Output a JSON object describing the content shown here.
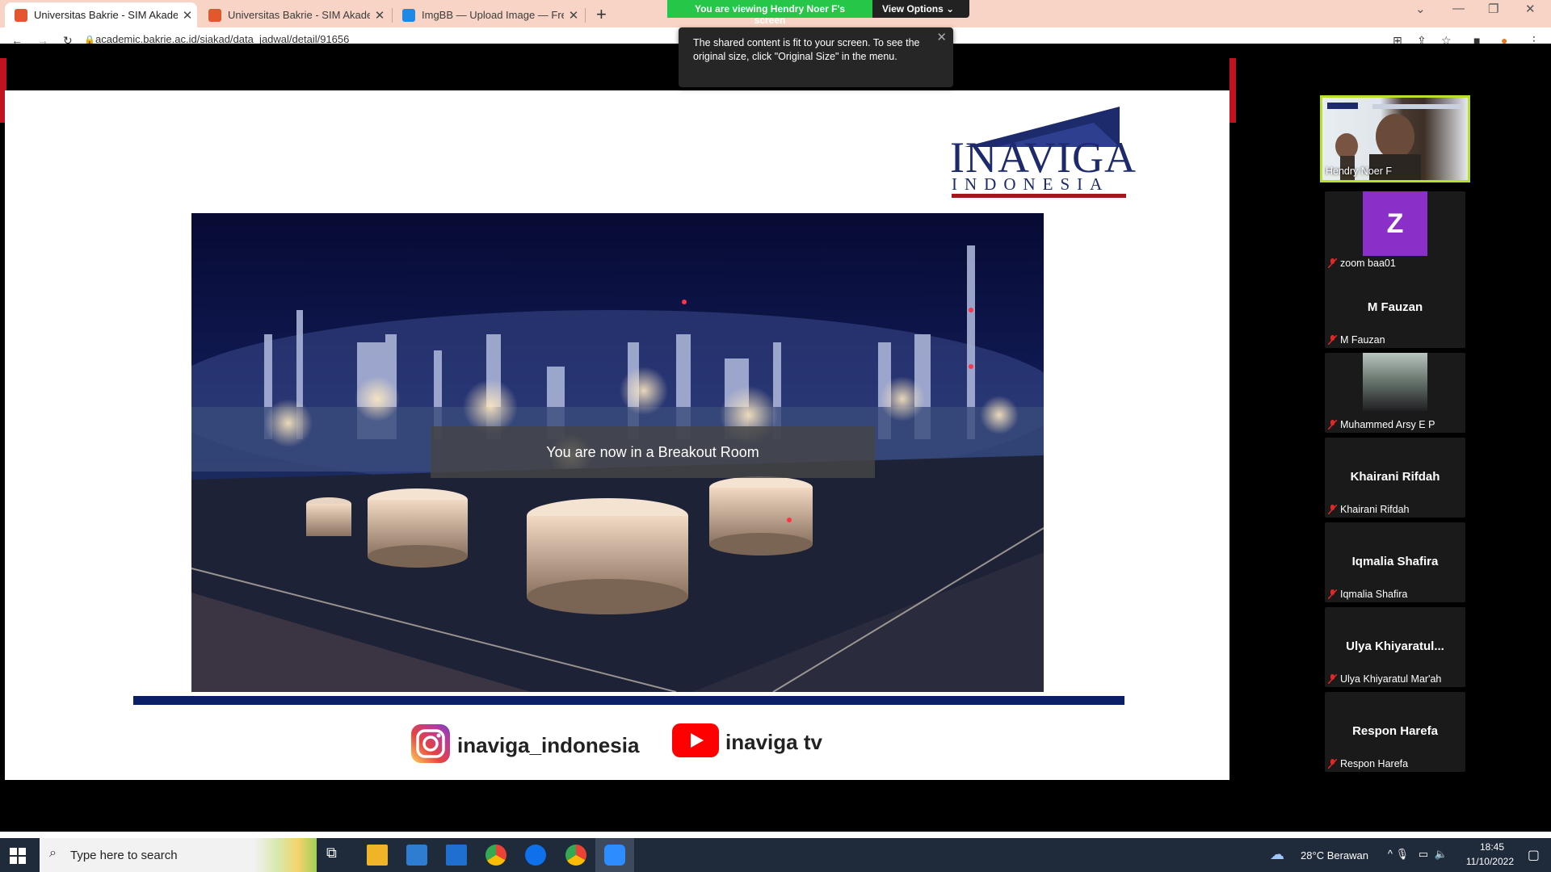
{
  "browser": {
    "tabs": [
      {
        "title": "Universitas Bakrie - SIM Akadem",
        "active": true
      },
      {
        "title": "Universitas Bakrie - SIM Akadem",
        "active": false
      },
      {
        "title": "ImgBB — Upload Image — Free",
        "active": false
      }
    ],
    "url": "academic.bakrie.ac.id/siakad/data_jadwal/detail/91656"
  },
  "share_banner": {
    "viewing": "You are viewing Hendry Noer F's screen",
    "options": "View Options"
  },
  "tooltip": {
    "line1": "The shared content is fit to your screen. To see the",
    "line2": "original size, click \"Original Size\" in the menu."
  },
  "slide": {
    "logo_text_top": "INAVIGA",
    "logo_text_bottom": "INDONESIA",
    "breakout": "You are now in a Breakout Room",
    "instagram": "inaviga_indonesia",
    "youtube": "inaviga tv"
  },
  "participants": {
    "active": {
      "label": "Hendry Noer F"
    },
    "list": [
      {
        "display": "",
        "label": "zoom baa01",
        "avatar": "Z"
      },
      {
        "display": "M Fauzan",
        "label": "M Fauzan"
      },
      {
        "display": "",
        "label": "Muhammed Arsy E P"
      },
      {
        "display": "Khairani Rifdah",
        "label": "Khairani Rifdah"
      },
      {
        "display": "Iqmalia Shafira",
        "label": "Iqmalia Shafira"
      },
      {
        "display": "Ulya  Khiyaratul...",
        "label": "Ulya Khiyaratul Mar'ah"
      },
      {
        "display": "Respon Harefa",
        "label": "Respon Harefa"
      }
    ]
  },
  "taskbar": {
    "search_placeholder": "Type here to search",
    "weather": "28°C  Berawan",
    "time": "18:45",
    "date": "11/10/2022"
  }
}
